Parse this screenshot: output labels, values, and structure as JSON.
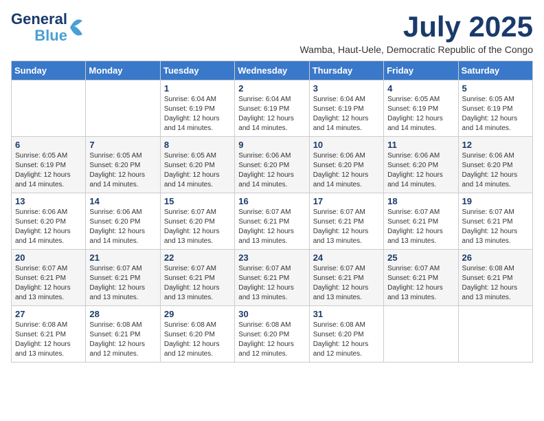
{
  "logo": {
    "line1": "General",
    "line2": "Blue"
  },
  "title": "July 2025",
  "location": "Wamba, Haut-Uele, Democratic Republic of the Congo",
  "weekdays": [
    "Sunday",
    "Monday",
    "Tuesday",
    "Wednesday",
    "Thursday",
    "Friday",
    "Saturday"
  ],
  "weeks": [
    [
      {
        "day": "",
        "info": ""
      },
      {
        "day": "",
        "info": ""
      },
      {
        "day": "1",
        "info": "Sunrise: 6:04 AM\nSunset: 6:19 PM\nDaylight: 12 hours and 14 minutes."
      },
      {
        "day": "2",
        "info": "Sunrise: 6:04 AM\nSunset: 6:19 PM\nDaylight: 12 hours and 14 minutes."
      },
      {
        "day": "3",
        "info": "Sunrise: 6:04 AM\nSunset: 6:19 PM\nDaylight: 12 hours and 14 minutes."
      },
      {
        "day": "4",
        "info": "Sunrise: 6:05 AM\nSunset: 6:19 PM\nDaylight: 12 hours and 14 minutes."
      },
      {
        "day": "5",
        "info": "Sunrise: 6:05 AM\nSunset: 6:19 PM\nDaylight: 12 hours and 14 minutes."
      }
    ],
    [
      {
        "day": "6",
        "info": "Sunrise: 6:05 AM\nSunset: 6:19 PM\nDaylight: 12 hours and 14 minutes."
      },
      {
        "day": "7",
        "info": "Sunrise: 6:05 AM\nSunset: 6:20 PM\nDaylight: 12 hours and 14 minutes."
      },
      {
        "day": "8",
        "info": "Sunrise: 6:05 AM\nSunset: 6:20 PM\nDaylight: 12 hours and 14 minutes."
      },
      {
        "day": "9",
        "info": "Sunrise: 6:06 AM\nSunset: 6:20 PM\nDaylight: 12 hours and 14 minutes."
      },
      {
        "day": "10",
        "info": "Sunrise: 6:06 AM\nSunset: 6:20 PM\nDaylight: 12 hours and 14 minutes."
      },
      {
        "day": "11",
        "info": "Sunrise: 6:06 AM\nSunset: 6:20 PM\nDaylight: 12 hours and 14 minutes."
      },
      {
        "day": "12",
        "info": "Sunrise: 6:06 AM\nSunset: 6:20 PM\nDaylight: 12 hours and 14 minutes."
      }
    ],
    [
      {
        "day": "13",
        "info": "Sunrise: 6:06 AM\nSunset: 6:20 PM\nDaylight: 12 hours and 14 minutes."
      },
      {
        "day": "14",
        "info": "Sunrise: 6:06 AM\nSunset: 6:20 PM\nDaylight: 12 hours and 14 minutes."
      },
      {
        "day": "15",
        "info": "Sunrise: 6:07 AM\nSunset: 6:20 PM\nDaylight: 12 hours and 13 minutes."
      },
      {
        "day": "16",
        "info": "Sunrise: 6:07 AM\nSunset: 6:21 PM\nDaylight: 12 hours and 13 minutes."
      },
      {
        "day": "17",
        "info": "Sunrise: 6:07 AM\nSunset: 6:21 PM\nDaylight: 12 hours and 13 minutes."
      },
      {
        "day": "18",
        "info": "Sunrise: 6:07 AM\nSunset: 6:21 PM\nDaylight: 12 hours and 13 minutes."
      },
      {
        "day": "19",
        "info": "Sunrise: 6:07 AM\nSunset: 6:21 PM\nDaylight: 12 hours and 13 minutes."
      }
    ],
    [
      {
        "day": "20",
        "info": "Sunrise: 6:07 AM\nSunset: 6:21 PM\nDaylight: 12 hours and 13 minutes."
      },
      {
        "day": "21",
        "info": "Sunrise: 6:07 AM\nSunset: 6:21 PM\nDaylight: 12 hours and 13 minutes."
      },
      {
        "day": "22",
        "info": "Sunrise: 6:07 AM\nSunset: 6:21 PM\nDaylight: 12 hours and 13 minutes."
      },
      {
        "day": "23",
        "info": "Sunrise: 6:07 AM\nSunset: 6:21 PM\nDaylight: 12 hours and 13 minutes."
      },
      {
        "day": "24",
        "info": "Sunrise: 6:07 AM\nSunset: 6:21 PM\nDaylight: 12 hours and 13 minutes."
      },
      {
        "day": "25",
        "info": "Sunrise: 6:07 AM\nSunset: 6:21 PM\nDaylight: 12 hours and 13 minutes."
      },
      {
        "day": "26",
        "info": "Sunrise: 6:08 AM\nSunset: 6:21 PM\nDaylight: 12 hours and 13 minutes."
      }
    ],
    [
      {
        "day": "27",
        "info": "Sunrise: 6:08 AM\nSunset: 6:21 PM\nDaylight: 12 hours and 13 minutes."
      },
      {
        "day": "28",
        "info": "Sunrise: 6:08 AM\nSunset: 6:21 PM\nDaylight: 12 hours and 12 minutes."
      },
      {
        "day": "29",
        "info": "Sunrise: 6:08 AM\nSunset: 6:20 PM\nDaylight: 12 hours and 12 minutes."
      },
      {
        "day": "30",
        "info": "Sunrise: 6:08 AM\nSunset: 6:20 PM\nDaylight: 12 hours and 12 minutes."
      },
      {
        "day": "31",
        "info": "Sunrise: 6:08 AM\nSunset: 6:20 PM\nDaylight: 12 hours and 12 minutes."
      },
      {
        "day": "",
        "info": ""
      },
      {
        "day": "",
        "info": ""
      }
    ]
  ]
}
